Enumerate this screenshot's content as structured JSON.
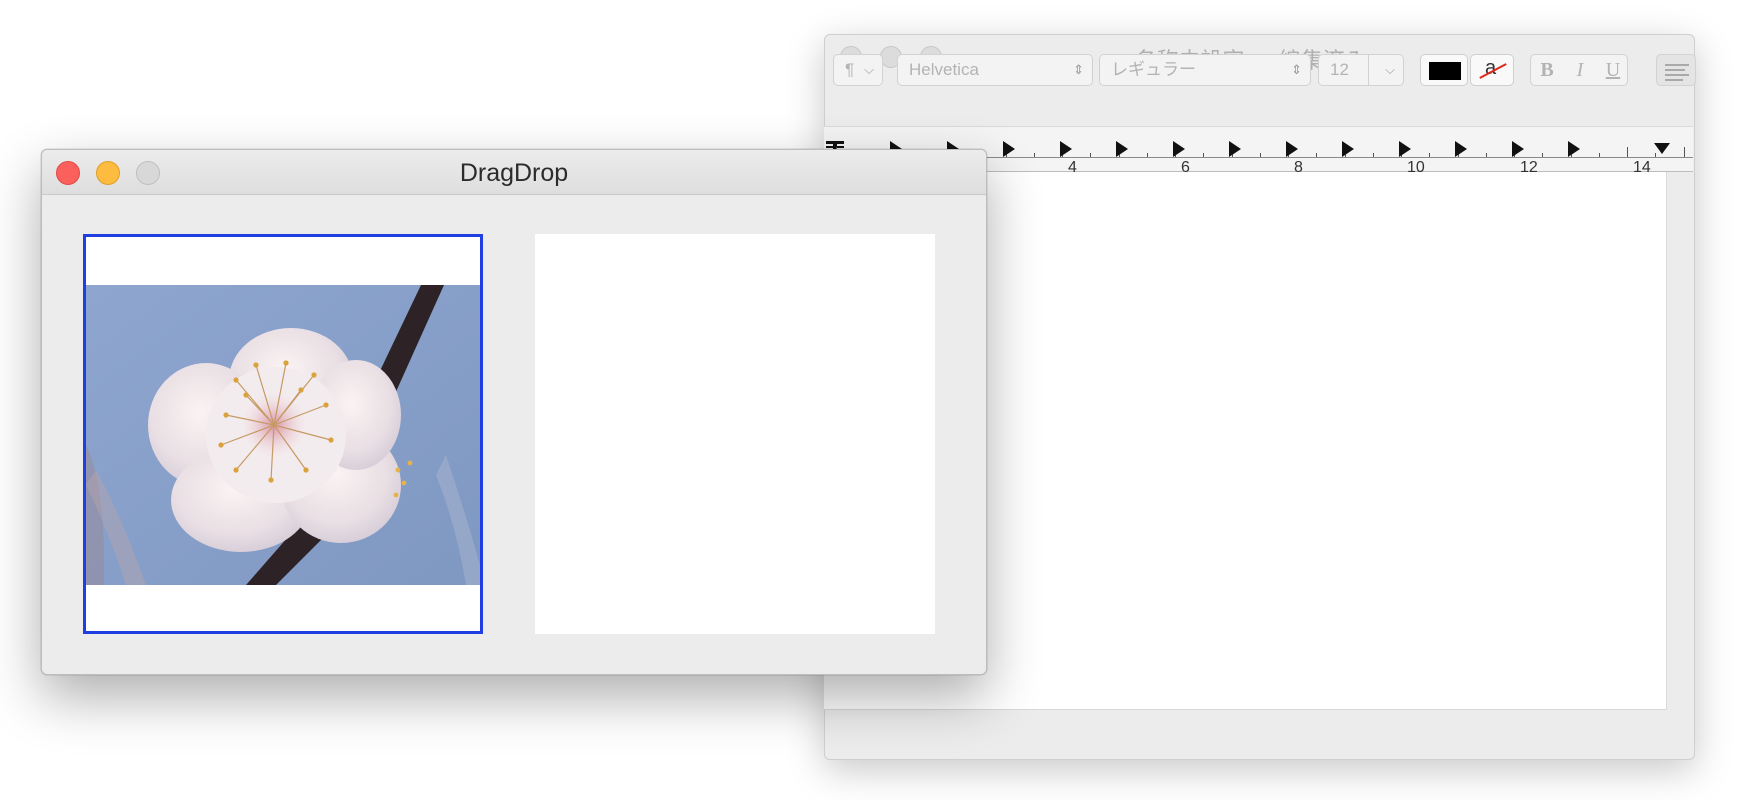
{
  "textedit": {
    "title": "名称未設定",
    "title_separator": "—",
    "edited_label": "編集済み",
    "paragraph_button": "¶",
    "font_family": "Helvetica",
    "font_style": "レギュラー",
    "font_size": "12",
    "bold_label": "B",
    "italic_label": "I",
    "underline_label": "U",
    "bg_color_letter": "a",
    "text_color": "#000000",
    "ruler_numbers": [
      "4",
      "6",
      "8",
      "10",
      "12",
      "14"
    ]
  },
  "dragdrop": {
    "title": "DragDrop",
    "traffic_colors": [
      "#fc605c",
      "#fdbc40",
      "#d8d8d8"
    ],
    "selection_color": "#1f3fe0"
  },
  "icons": {
    "paragraph": "pilcrow-icon",
    "chevron": "chevron-down-icon",
    "stepper": "up-down-stepper-icon",
    "align": "align-left-icon"
  }
}
